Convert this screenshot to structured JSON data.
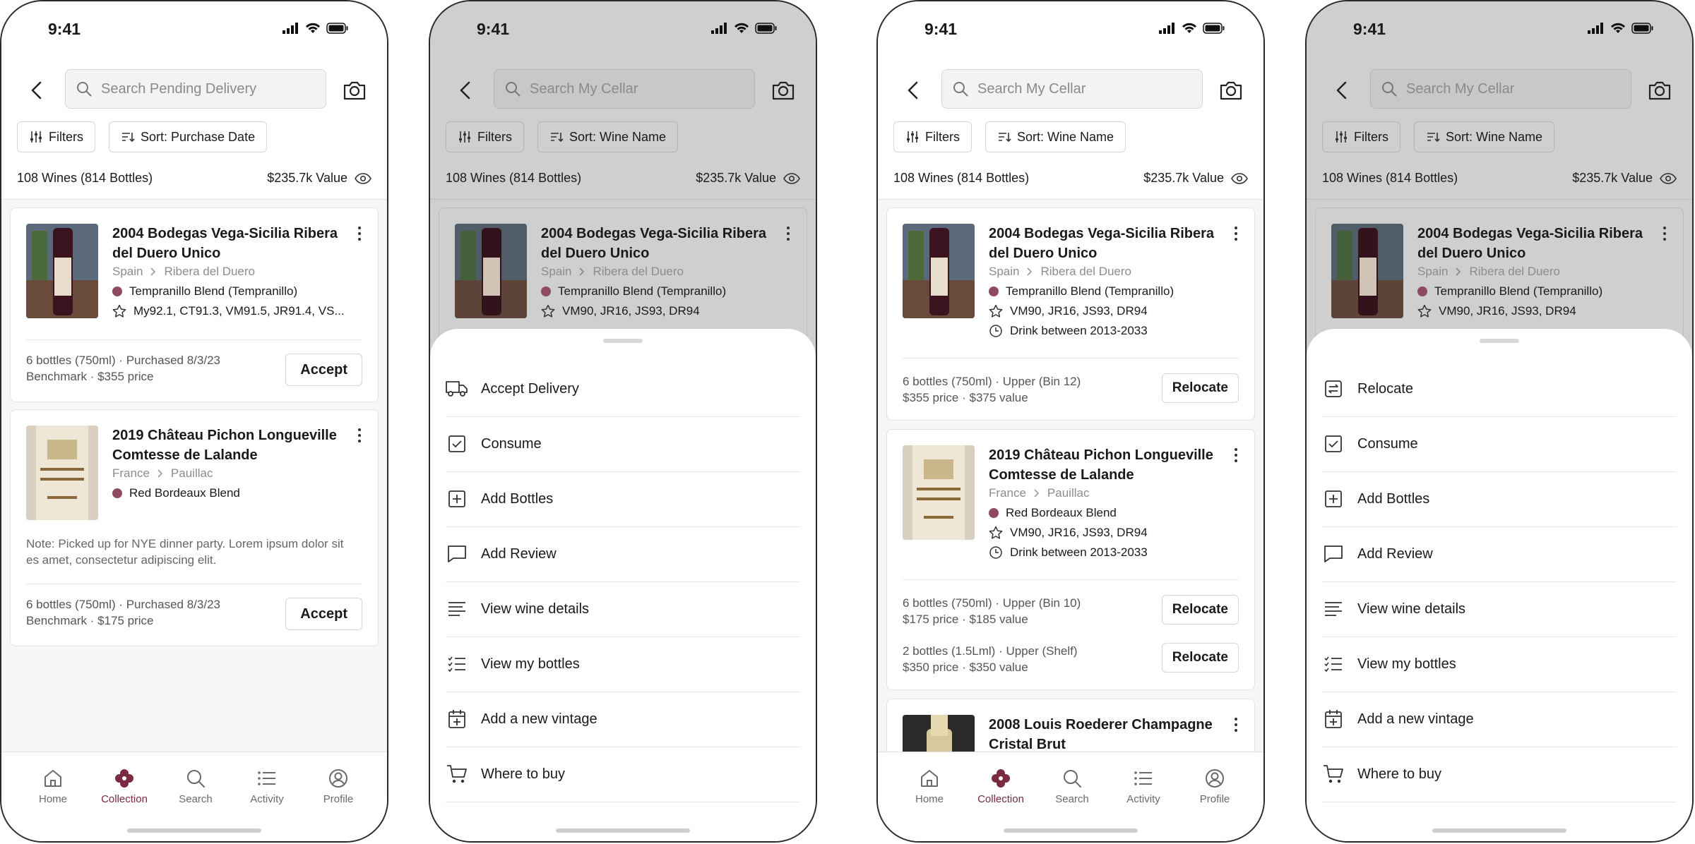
{
  "status": {
    "time": "9:41"
  },
  "screens": [
    {
      "search_placeholder": "Search Pending Delivery",
      "filters_label": "Filters",
      "sort_label": "Sort: Purchase Date",
      "count": "108 Wines (814 Bottles)",
      "value": "$235.7k Value",
      "cards": [
        {
          "title": "2004 Bodegas Vega-Sicilia Ribera del Duero Unico",
          "country": "Spain",
          "region": "Ribera del Duero",
          "varietal": "Tempranillo Blend (Tempranillo)",
          "scores": "My92.1, CT91.3, VM91.5, JR91.4, VS...",
          "foot1": "6 bottles (750ml) · Purchased 8/3/23",
          "foot2": "Benchmark · $355 price",
          "button": "Accept"
        },
        {
          "title": "2019 Château Pichon Longueville Comtesse de Lalande",
          "country": "France",
          "region": "Pauillac",
          "varietal": "Red Bordeaux Blend",
          "note": "Note: Picked up for NYE dinner party. Lorem ipsum dolor sit es amet, consectetur adipiscing elit.",
          "foot1": "6 bottles (750ml) · Purchased 8/3/23",
          "foot2": "Benchmark · $175 price",
          "button": "Accept"
        }
      ]
    },
    {
      "search_placeholder": "Search My Cellar",
      "filters_label": "Filters",
      "sort_label": "Sort: Wine Name",
      "count": "108 Wines (814 Bottles)",
      "value": "$235.7k Value",
      "card": {
        "title": "2004 Bodegas Vega-Sicilia Ribera del Duero Unico",
        "country": "Spain",
        "region": "Ribera del Duero",
        "varietal": "Tempranillo Blend (Tempranillo)",
        "scores": "VM90, JR16, JS93, DR94"
      },
      "menu": [
        {
          "icon": "truck-icon",
          "label": "Accept Delivery"
        },
        {
          "icon": "checkbox-icon",
          "label": "Consume"
        },
        {
          "icon": "plus-square-icon",
          "label": "Add Bottles"
        },
        {
          "icon": "comment-icon",
          "label": "Add Review"
        },
        {
          "icon": "text-lines-icon",
          "label": "View wine details"
        },
        {
          "icon": "checklist-icon",
          "label": "View my bottles"
        },
        {
          "icon": "calendar-plus-icon",
          "label": "Add a new vintage"
        },
        {
          "icon": "cart-icon",
          "label": "Where to buy"
        }
      ]
    },
    {
      "search_placeholder": "Search My Cellar",
      "filters_label": "Filters",
      "sort_label": "Sort: Wine Name",
      "count": "108 Wines (814 Bottles)",
      "value": "$235.7k Value",
      "cards": [
        {
          "title": "2004 Bodegas Vega-Sicilia Ribera del Duero Unico",
          "country": "Spain",
          "region": "Ribera del Duero",
          "varietal": "Tempranillo Blend (Tempranillo)",
          "scores": "VM90, JR16, JS93, DR94",
          "drink": "Drink between 2013-2033",
          "rows": [
            {
              "foot1": "6 bottles (750ml) · Upper (Bin 12)",
              "foot2": "$355 price · $375 value",
              "button": "Relocate"
            }
          ]
        },
        {
          "title": "2019 Château Pichon Longueville Comtesse de Lalande",
          "country": "France",
          "region": "Pauillac",
          "varietal": "Red Bordeaux Blend",
          "scores": "VM90, JR16, JS93, DR94",
          "drink": "Drink between 2013-2033",
          "rows": [
            {
              "foot1": "6 bottles (750ml) · Upper (Bin 10)",
              "foot2": "$175 price · $185 value",
              "button": "Relocate"
            },
            {
              "foot1": "2 bottles (1.5Lml) · Upper (Shelf)",
              "foot2": "$350 price · $350 value",
              "button": "Relocate"
            }
          ]
        },
        {
          "title": "2008 Louis Roederer Champagne Cristal Brut"
        }
      ]
    },
    {
      "search_placeholder": "Search My Cellar",
      "filters_label": "Filters",
      "sort_label": "Sort: Wine Name",
      "count": "108 Wines (814 Bottles)",
      "value": "$235.7k Value",
      "card": {
        "title": "2004 Bodegas Vega-Sicilia Ribera del Duero Unico",
        "country": "Spain",
        "region": "Ribera del Duero",
        "varietal": "Tempranillo Blend (Tempranillo)",
        "scores": "VM90, JR16, JS93, DR94"
      },
      "menu": [
        {
          "icon": "relocate-icon",
          "label": "Relocate"
        },
        {
          "icon": "checkbox-icon",
          "label": "Consume"
        },
        {
          "icon": "plus-square-icon",
          "label": "Add Bottles"
        },
        {
          "icon": "comment-icon",
          "label": "Add Review"
        },
        {
          "icon": "text-lines-icon",
          "label": "View wine details"
        },
        {
          "icon": "checklist-icon",
          "label": "View my bottles"
        },
        {
          "icon": "calendar-plus-icon",
          "label": "Add a new vintage"
        },
        {
          "icon": "cart-icon",
          "label": "Where to buy"
        }
      ]
    }
  ],
  "tabs": [
    {
      "label": "Home",
      "icon": "home-icon"
    },
    {
      "label": "Collection",
      "icon": "collection-icon",
      "active": true
    },
    {
      "label": "Search",
      "icon": "search-icon"
    },
    {
      "label": "Activity",
      "icon": "activity-icon"
    },
    {
      "label": "Profile",
      "icon": "profile-icon"
    }
  ],
  "colors": {
    "accent": "#7a2a41",
    "varietal_dot": "#8e4a5e",
    "overlay": "#cfcfcf"
  }
}
